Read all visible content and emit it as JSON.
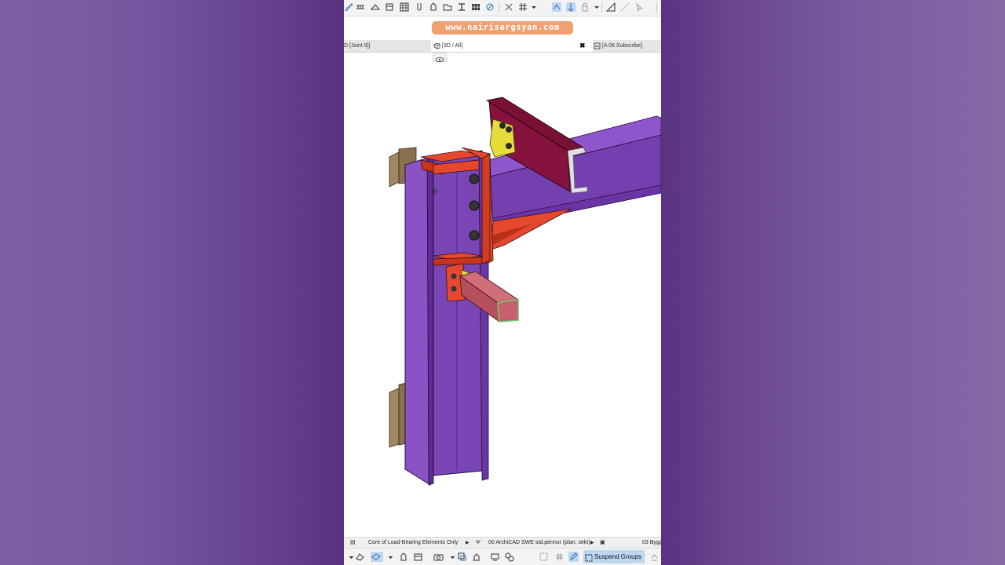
{
  "watermark": "www.nairisargsyan.com",
  "tabs": [
    {
      "label": "D [Joint 9]]"
    },
    {
      "label": "[3D / All]"
    },
    {
      "label": "[A 06 Subscribe]"
    }
  ],
  "status": {
    "structural_display": "Core of Load-Bearing Elements Only",
    "pen_set": "00 ArchiCAD SWE std.pennor (plan, sekt)",
    "layer": "03 Bygg"
  },
  "bottom": {
    "suspend_groups": "Suspend Groups"
  },
  "colors": {
    "column": "#7a45b4",
    "beam": "#8048c0",
    "plate": "#e5482e",
    "purlin": "#86123e",
    "cleat": "#e5dd3a",
    "bracket": "#8b7050",
    "tube": "#c55a69"
  }
}
